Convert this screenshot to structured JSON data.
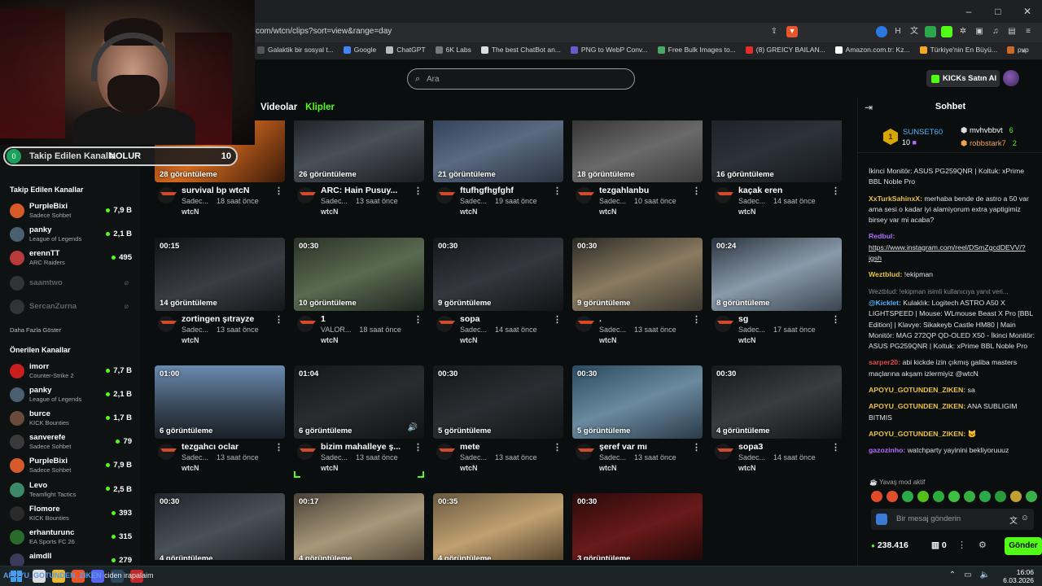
{
  "browser": {
    "url": "com/wtcn/clips?sort=view&range=day",
    "bookmarks": [
      {
        "label": "Galaktik bir sosyal t...",
        "color": "#555555"
      },
      {
        "label": "Google",
        "color": "#4285f4"
      },
      {
        "label": "ChatGPT",
        "color": "#bbbbbb"
      },
      {
        "label": "6K Labs",
        "color": "#777777"
      },
      {
        "label": "The best ChatBot an...",
        "color": "#dddddd"
      },
      {
        "label": "PNG to WebP Conv...",
        "color": "#6a5acd"
      },
      {
        "label": "Free Bulk Images to...",
        "color": "#44aa66"
      },
      {
        "label": "(8) GREICY BAILAN...",
        "color": "#e52d27"
      },
      {
        "label": "Amazon.com.tr: Kz...",
        "color": "#ffffff"
      },
      {
        "label": "Türkiye'nin En Büyü...",
        "color": "#f5a623"
      },
      {
        "label": "pvp",
        "color": "#c96a2a"
      }
    ],
    "bookmarks_more": "»",
    "window_controls": [
      "–",
      "□",
      "✕"
    ]
  },
  "header": {
    "search_placeholder": "Ara",
    "buy_kicks": "KICKs Satın Al"
  },
  "webcam_overlay": {
    "badge": "0",
    "label": "Takip Edilen Kanalla",
    "word": "NOLUR",
    "count": "10"
  },
  "sidebar": {
    "followed_title": "Takip Edilen Kanallar",
    "followed": [
      {
        "name": "PurpleBixi",
        "category": "Sadece Sohbet",
        "viewers": "7,9 B",
        "color": "#d65a2a"
      },
      {
        "name": "panky",
        "category": "League of Legends",
        "viewers": "2,1 B",
        "color": "#4a6070"
      },
      {
        "name": "erennTT",
        "category": "ARC Raiders",
        "viewers": "495",
        "color": "#b83a3a"
      }
    ],
    "offline": [
      {
        "name": "saamtwo",
        "color": "#666666"
      },
      {
        "name": "SercanZurna",
        "color": "#666666"
      }
    ],
    "show_more": "Daha Fazla Göster",
    "recommended_title": "Önerilen Kanallar",
    "recommended": [
      {
        "name": "imorr",
        "category": "Counter-Strike 2",
        "viewers": "7,7 B",
        "color": "#c81e1e"
      },
      {
        "name": "panky",
        "category": "League of Legends",
        "viewers": "2,1 B",
        "color": "#4a6070"
      },
      {
        "name": "burce",
        "category": "KICK Bounties",
        "viewers": "1,7 B",
        "color": "#6a4a3a"
      },
      {
        "name": "sanverefe",
        "category": "Sadece Sohbet",
        "viewers": "79",
        "color": "#3a3a3a"
      },
      {
        "name": "PurpleBixi",
        "category": "Sadece Sohbet",
        "viewers": "7,9 B",
        "color": "#d65a2a"
      },
      {
        "name": "Levo",
        "category": "Teamfight Tactics",
        "viewers": "2,5 B",
        "color": "#3a8a6a"
      },
      {
        "name": "Flomore",
        "category": "KICK Bounties",
        "viewers": "393",
        "color": "#2a2a2a"
      },
      {
        "name": "erhanturunc",
        "category": "EA Sports FC 26",
        "viewers": "315",
        "color": "#2a6a2a"
      },
      {
        "name": "aimdll",
        "category": "",
        "viewers": "279",
        "color": "#3a3a5a"
      }
    ]
  },
  "tabs": [
    {
      "label": "Videolar",
      "active": false
    },
    {
      "label": "Klipler",
      "active": true
    }
  ],
  "clips": [
    {
      "duration": "",
      "views": "28 görüntüleme",
      "title": "survival bp wtcN",
      "channel": "Sadec...",
      "time": "18 saat önce",
      "author": "wtcN",
      "bg": "linear-gradient(135deg,#6a2a0a,#d2691e 45%,#3a1a0a)"
    },
    {
      "duration": "",
      "views": "26 görüntüleme",
      "title": "ARC: Hain Pusuy...",
      "channel": "Sadec...",
      "time": "13 saat önce",
      "author": "wtcN",
      "bg": "linear-gradient(160deg,#15181c,#4a5058 50%,#1a1c20)"
    },
    {
      "duration": "",
      "views": "21 görüntüleme",
      "title": "ftufhgfhgfghf",
      "channel": "Sadec...",
      "time": "19 saat önce",
      "author": "wtcN",
      "bg": "linear-gradient(160deg,#2a3a50,#5a6a80 50%,#2a3240)"
    },
    {
      "duration": "",
      "views": "18 görüntüleme",
      "title": "tezgahlanbu",
      "channel": "Sadec...",
      "time": "10 saat önce",
      "author": "wtcN",
      "bg": "linear-gradient(160deg,#2a2a2a,#6a6a6a 55%,#3a3a3a)"
    },
    {
      "duration": "",
      "views": "16 görüntüleme",
      "title": "kaçak eren",
      "channel": "Sadec...",
      "time": "14 saat önce",
      "author": "wtcN",
      "bg": "linear-gradient(160deg,#1a1f24,#2c3238 50%,#14181c)"
    },
    {
      "duration": "00:15",
      "views": "14 görüntüleme",
      "title": "zortingen şıtrayze",
      "channel": "Sadec...",
      "time": "13 saat önce",
      "author": "wtcN",
      "bg": "linear-gradient(160deg,#101214,#3a3e44 55%,#15171a)"
    },
    {
      "duration": "00:30",
      "views": "10 görüntüleme",
      "title": "1",
      "channel": "VALOR...",
      "time": "18 saat önce",
      "author": "wtcN",
      "bg": "linear-gradient(160deg,#2a3228,#5a6a50 50%,#1e2620)"
    },
    {
      "duration": "00:30",
      "views": "9 görüntüleme",
      "title": "sopa",
      "channel": "Sadec...",
      "time": "14 saat önce",
      "author": "wtcN",
      "bg": "linear-gradient(160deg,#14161a,#34383e 50%,#121416)"
    },
    {
      "duration": "00:30",
      "views": "9 görüntüleme",
      "title": ".",
      "channel": "Sadec...",
      "time": "13 saat önce",
      "author": "wtcN",
      "bg": "linear-gradient(160deg,#2a2a26,#8a7a60 50%,#3a3830)"
    },
    {
      "duration": "00:24",
      "views": "8 görüntüleme",
      "title": "sg",
      "channel": "Sadec...",
      "time": "17 saat önce",
      "author": "wtcN",
      "bg": "linear-gradient(160deg,#2a3440,#8a9aaa 50%,#3a4450)"
    },
    {
      "duration": "01:00",
      "views": "6 görüntüleme",
      "title": "tezgahcı oclar",
      "channel": "Sadec...",
      "time": "13 saat önce",
      "author": "wtcN",
      "bg": "linear-gradient(180deg,#6a8ab0,#3a4a5a 55%,#1a2028)"
    },
    {
      "duration": "01:04",
      "views": "6 görüntüleme",
      "title": "bizim mahalleye ş...",
      "channel": "Sadec...",
      "time": "13 saat önce",
      "author": "wtcN",
      "bg": "linear-gradient(160deg,#141618,#2a2c30 50%,#101214)"
    },
    {
      "duration": "00:30",
      "views": "5 görüntüleme",
      "title": "mete",
      "channel": "Sadec...",
      "time": "13 saat önce",
      "author": "wtcN",
      "bg": "linear-gradient(160deg,#16181a,#2a2e32 50%,#121416)"
    },
    {
      "duration": "00:30",
      "views": "5 görüntüleme",
      "title": "şeref var mı",
      "channel": "Sadec...",
      "time": "13 saat önce",
      "author": "wtcN",
      "bg": "linear-gradient(160deg,#2a4a60,#6a8aa0 50%,#2a3a48)"
    },
    {
      "duration": "00:30",
      "views": "4 görüntüleme",
      "title": "sopa3",
      "channel": "Sadec...",
      "time": "14 saat önce",
      "author": "wtcN",
      "bg": "linear-gradient(160deg,#16181a,#3a3c3e 50%,#121314)"
    },
    {
      "duration": "00:30",
      "views": "4 görüntüleme",
      "title": "",
      "channel": "",
      "time": "",
      "author": "",
      "bg": "linear-gradient(160deg,#20252a,#4a5058 50%,#1a1e22)"
    },
    {
      "duration": "00:17",
      "views": "4 görüntüleme",
      "title": "",
      "channel": "",
      "time": "",
      "author": "",
      "bg": "linear-gradient(160deg,#4a4238,#a8987a 50%,#4a4030)"
    },
    {
      "duration": "00:35",
      "views": "4 görüntüleme",
      "title": "",
      "channel": "",
      "time": "",
      "author": "",
      "bg": "linear-gradient(160deg,#6a5a40,#c0a070 50%,#4a3a28)"
    },
    {
      "duration": "00:30",
      "views": "3 görüntüleme",
      "title": "",
      "channel": "",
      "time": "",
      "author": "",
      "bg": "linear-gradient(160deg,#2a0a0a,#6a1a1a 50%,#1a0606)"
    }
  ],
  "chat": {
    "title": "Sohbet",
    "gifter_top": {
      "name": "SUNSET60",
      "count": "10",
      "rank": "1"
    },
    "gifter_2": {
      "name": "mvhvbbvt",
      "count": "6"
    },
    "gifter_3": {
      "name": "robbstark7",
      "count": "2"
    },
    "messages": [
      {
        "user": "",
        "color": "#ffffff",
        "text": "İkinci Monitör: ASUS PG259QNR | Koltuk: xPrime BBL Noble Pro",
        "reply": ""
      },
      {
        "user": "XxTurkSahinxX:",
        "color": "#e8c04a",
        "text": " merhaba bende de astro a 50 var ama sesi o kadar iyi alamiyorum extra yaptigimiz birsey var mi acaba?",
        "reply": ""
      },
      {
        "user": "Redbul:",
        "color": "#b06cff",
        "text": " https://www.instagram.com/reel/DSmZgcdDEVV/?igsh",
        "reply": ""
      },
      {
        "user": "Weztblud:",
        "color": "#e8c04a",
        "text": " !ekipman",
        "reply": ""
      },
      {
        "user": "@Kicklet:",
        "color": "#4fb5ff",
        "text": " Kulaklık: Logitech ASTRO A50 X LIGHTSPEED | Mouse: WLmouse Beast X Pro [BBL Edition] | Klavye: Sikakeyb Castle HM80 | Main Monitör: MAG 272QP QD-OLED X50 - İkinci Monitör: ASUS PG259QNR | Koltuk: xPrime BBL Noble Pro",
        "reply": "Weztblud: !ekipman isimli kullanıcıya yanıt veri..."
      },
      {
        "user": "sarper20:",
        "color": "#e04a4a",
        "text": " abi kickde izin çıkmış galiba masters maçlarına akşam izlermiyiz @wtcN",
        "reply": ""
      },
      {
        "user": "APOYU_GOTUNDEN_ZIKEN:",
        "color": "#e8c04a",
        "text": " sa",
        "reply": ""
      },
      {
        "user": "APOYU_GOTUNDEN_ZIKEN:",
        "color": "#e8c04a",
        "text": " ANA SUBLIGIM BITMIS",
        "reply": ""
      },
      {
        "user": "APOYU_GOTUNDEN_ZIKEN:",
        "color": "#e8c04a",
        "text": " 🐱",
        "reply": ""
      },
      {
        "user": "gazozinho:",
        "color": "#b06cff",
        "text": " watchparty yayinini bekliyoruuuz",
        "reply": ""
      }
    ],
    "slow_mode": "Yavaş mod aktif",
    "input_placeholder": "Bir mesaj gönderin",
    "points": "238.416",
    "zero": "0",
    "send_label": "Gönder"
  },
  "taskbar": {
    "ticker": "APOYU_GOTUNDEN_ZIKEN",
    "ticker_text": "ciden irapalaim",
    "clock_time": "16:06",
    "clock_date": "6.03.2026"
  }
}
